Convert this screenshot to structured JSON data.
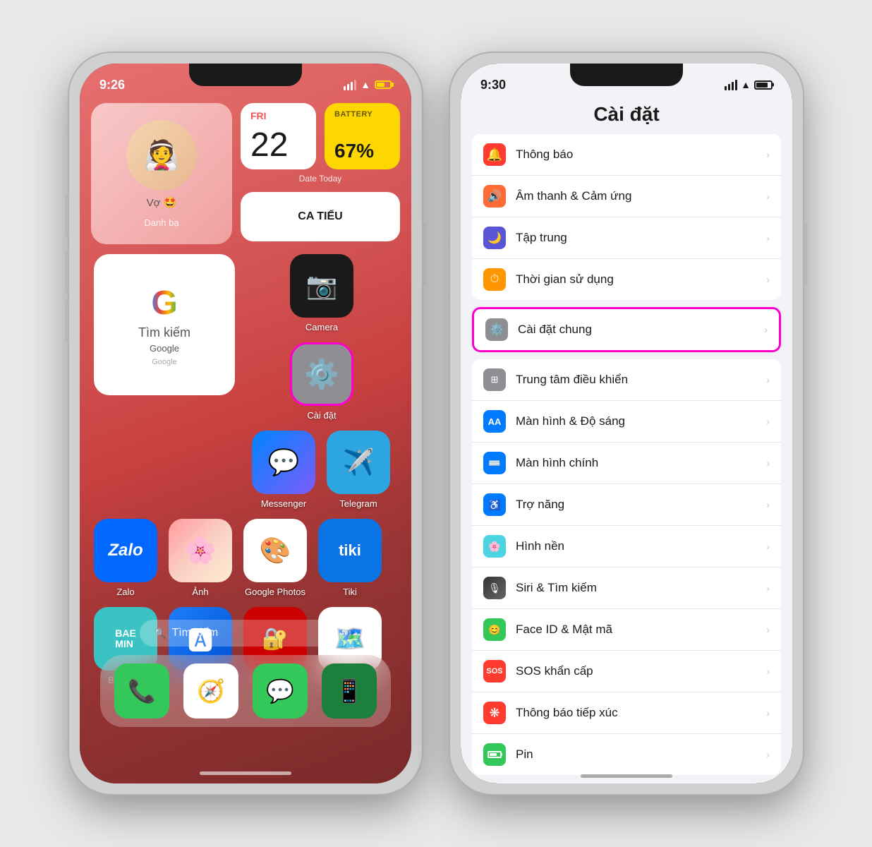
{
  "phone1": {
    "status": {
      "time": "9:26",
      "battery_color": "#ffd700"
    },
    "widgets": {
      "contact_name": "Vợ 🤩",
      "contact_label": "Danh bạ",
      "date_day": "FRI",
      "date_num": "22",
      "date_label": "Date Today",
      "battery_label": "BATTERY",
      "battery_pct": "67%",
      "shortcut_label": "CA TIẾU"
    },
    "apps": [
      {
        "name": "Google",
        "label": "Google",
        "bg": "#fff",
        "emoji": "G"
      },
      {
        "name": "Camera",
        "label": "Camera",
        "bg": "#1a1a1a",
        "emoji": "📷"
      },
      {
        "name": "Cài đặt",
        "label": "Cài đặt",
        "bg": "#d0d0d0",
        "emoji": "⚙️",
        "highlight": true
      },
      {
        "name": "Messenger",
        "label": "Messenger",
        "bg": "#0084ff",
        "emoji": "💬"
      },
      {
        "name": "Telegram",
        "label": "Telegram",
        "bg": "#2ca5e0",
        "emoji": "✈️"
      },
      {
        "name": "Zalo",
        "label": "Zalo",
        "bg": "#0068ff",
        "emoji": "Z"
      },
      {
        "name": "Ảnh",
        "label": "Ảnh",
        "bg": "#fff",
        "emoji": "🌸"
      },
      {
        "name": "Google Photos",
        "label": "Google Photos",
        "bg": "#fff",
        "emoji": "🎨"
      },
      {
        "name": "Tiki",
        "label": "Tiki",
        "bg": "#0b74e5",
        "emoji": "🛒"
      },
      {
        "name": "BAEMIN",
        "label": "BAEMIN",
        "bg": "#3bc3c3",
        "emoji": "🍱"
      },
      {
        "name": "App Store",
        "label": "App Store",
        "bg": "#0072f5",
        "emoji": "A"
      },
      {
        "name": "Authenticator",
        "label": "Authenticator",
        "bg": "#e00",
        "emoji": "🔐"
      },
      {
        "name": "Google Maps",
        "label": "Google Maps",
        "bg": "#fff",
        "emoji": "🗺️"
      }
    ],
    "search_placeholder": "Tìm kiếm",
    "dock": [
      {
        "name": "Phone",
        "bg": "#34c759",
        "emoji": "📞"
      },
      {
        "name": "Safari",
        "bg": "#fff",
        "emoji": "🧭"
      },
      {
        "name": "Messages",
        "bg": "#34c759",
        "emoji": "💬"
      },
      {
        "name": "Unknown",
        "bg": "#1d7f3c",
        "emoji": "📱"
      }
    ]
  },
  "phone2": {
    "status": {
      "time": "9:30"
    },
    "title": "Cài đặt",
    "settings": [
      {
        "items": [
          {
            "icon": "🔔",
            "icon_bg": "icon-red",
            "label": "Thông báo"
          },
          {
            "icon": "🔊",
            "icon_bg": "icon-orange-red",
            "label": "Âm thanh & Cảm ứng"
          },
          {
            "icon": "🌙",
            "icon_bg": "icon-purple",
            "label": "Tập trung"
          },
          {
            "icon": "⏱",
            "icon_bg": "icon-orange",
            "label": "Thời gian sử dụng"
          }
        ]
      },
      {
        "highlighted": true,
        "items": [
          {
            "icon": "⚙️",
            "icon_bg": "icon-gray",
            "label": "Cài đặt chung",
            "highlight": true
          }
        ]
      },
      {
        "items": [
          {
            "icon": "🎛",
            "icon_bg": "icon-gray",
            "label": "Trung tâm điều khiển"
          },
          {
            "icon": "AA",
            "icon_bg": "icon-blue",
            "label": "Màn hình & Độ sáng"
          },
          {
            "icon": "⌨️",
            "icon_bg": "icon-blue",
            "label": "Màn hình chính"
          },
          {
            "icon": "♿",
            "icon_bg": "icon-blue",
            "label": "Trợ năng"
          },
          {
            "icon": "🌸",
            "icon_bg": "icon-light-blue",
            "label": "Hình nền"
          },
          {
            "icon": "🎙",
            "icon_bg": "icon-siri",
            "label": "Siri & Tìm kiếm"
          },
          {
            "icon": "😊",
            "icon_bg": "icon-green",
            "label": "Face ID & Mật mã"
          },
          {
            "icon": "SOS",
            "icon_bg": "icon-sos",
            "label": "SOS khẩn cấp"
          },
          {
            "icon": "❋",
            "icon_bg": "icon-red",
            "label": "Thông báo tiếp xúc"
          },
          {
            "icon": "▬",
            "icon_bg": "icon-green",
            "label": "Pin"
          },
          {
            "icon": "📊",
            "icon_bg": "icon-blue",
            "label": "..."
          }
        ]
      }
    ]
  }
}
